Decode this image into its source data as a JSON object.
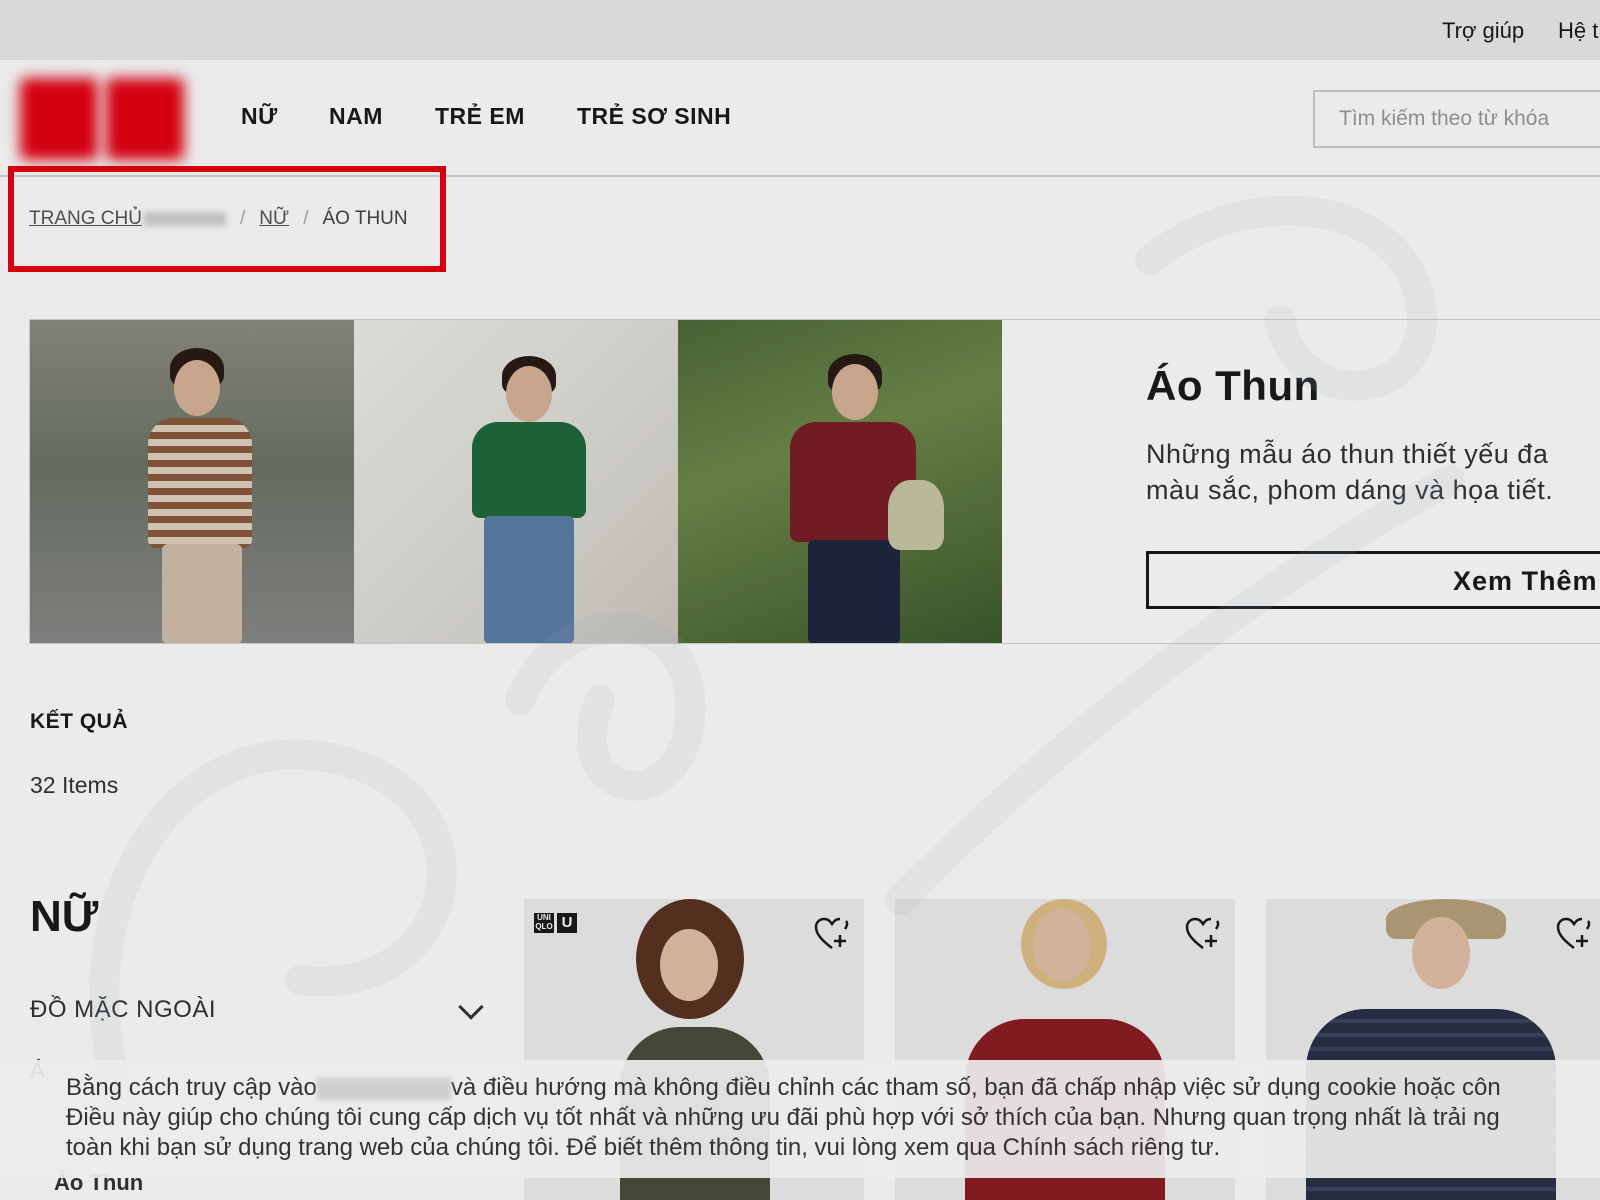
{
  "colors": {
    "brand_red": "#e60012",
    "highlight_red": "#e6000f",
    "text_dark": "#1b1b1b",
    "border_gray": "#d6d6d6"
  },
  "utility_bar": {
    "help": "Trợ giúp",
    "system": "Hệ t"
  },
  "header": {
    "nav": [
      "NỮ",
      "NAM",
      "TRẺ EM",
      "TRẺ SƠ SINH"
    ],
    "search_placeholder": "Tìm kiếm theo từ khóa"
  },
  "breadcrumb": {
    "home": "TRANG CHỦ",
    "section": "NỮ",
    "current": "ÁO THUN",
    "separator": "/"
  },
  "hero": {
    "title": "Áo Thun",
    "description_lines": [
      "Những mẫu áo thun thiết yếu đa",
      "màu sắc, phom dáng và họa tiết."
    ],
    "button_label": "Xem Thêm"
  },
  "results": {
    "label": "KẾT QUẢ",
    "count": "32 Items"
  },
  "sidebar": {
    "title": "NỮ",
    "category": "ĐỒ MẶC NGOÀI",
    "sub1": "Á",
    "sub2": "Áo Thun"
  },
  "products": [
    {
      "badge": [
        "UNI QLO",
        "U"
      ],
      "wishlist_icon": "heart-plus-icon"
    },
    {
      "wishlist_icon": "heart-plus-icon"
    },
    {
      "wishlist_icon": "heart-plus-icon"
    }
  ],
  "cookie": {
    "line1_before": "Bằng cách truy cập vào",
    "line1_after": "và điều hướng mà không điều chỉnh các tham số, bạn đã chấp nhập việc sử dụng cookie hoặc côn",
    "line2": "Điều này giúp cho chúng tôi cung cấp dịch vụ tốt nhất và những ưu đãi phù hợp với sở thích của bạn. Nhưng quan trọng nhất là trải ng",
    "line3_before": "toàn khi bạn sử dụng trang web của chúng tôi. Để biết thêm thông tin, vui lòng xem qua",
    "line3_link": "Chính sách riêng tư."
  }
}
